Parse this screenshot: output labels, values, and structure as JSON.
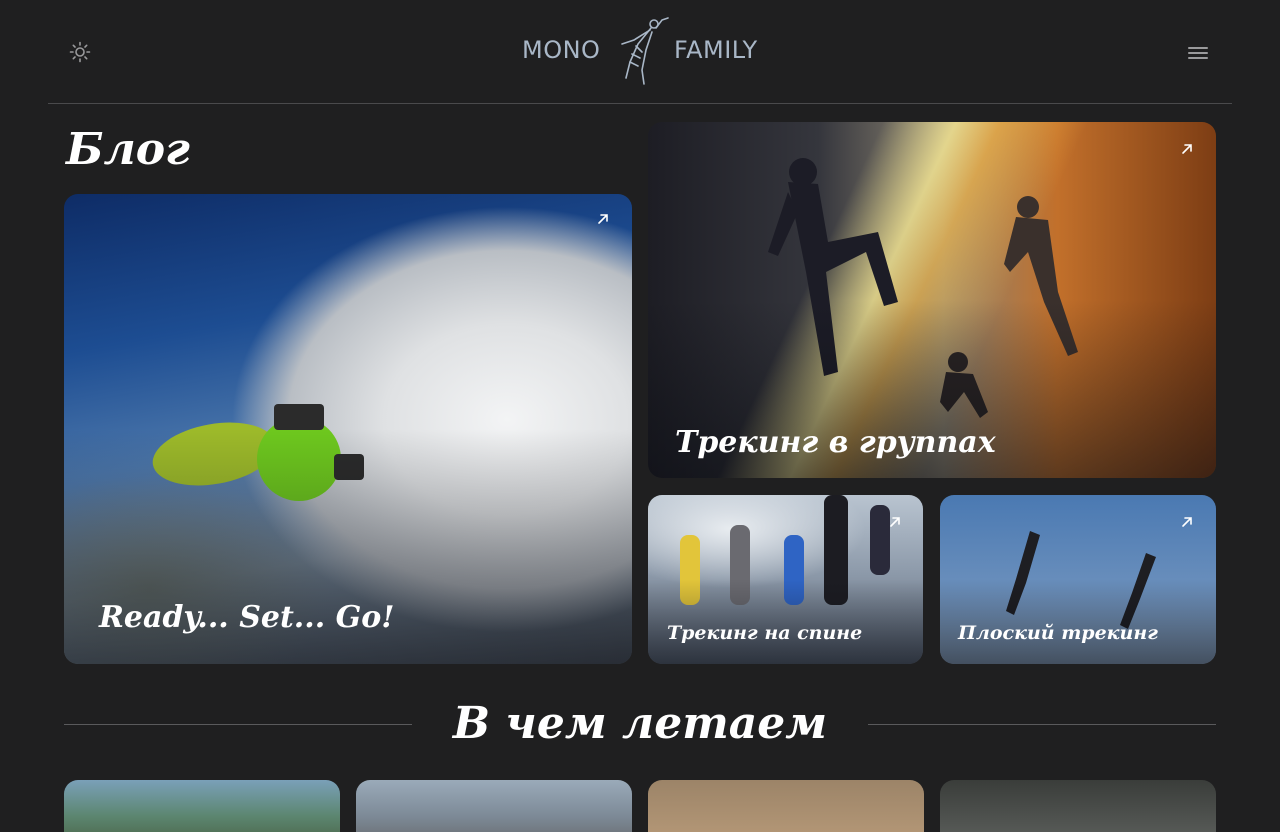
{
  "header": {
    "logo_left": "MONO",
    "logo_right": "FAMILY",
    "theme_icon": "sun-icon",
    "menu_icon": "hamburger-menu-icon"
  },
  "blog": {
    "title": "Блог",
    "cards": [
      {
        "title": "Ready... Set... Go!",
        "icon": "arrow-up-right-icon"
      },
      {
        "title": "Трекинг в группах",
        "icon": "arrow-up-right-icon"
      },
      {
        "title": "Трекинг на спине",
        "icon": "arrow-up-right-icon"
      },
      {
        "title": "Плоский трекинг",
        "icon": "arrow-up-right-icon"
      }
    ]
  },
  "gear_section": {
    "title": "В чем летаем"
  },
  "colors": {
    "background": "#1f1f20",
    "logo": "#a9b7c7",
    "divider": "#4a4a4c",
    "text": "#ffffff"
  }
}
